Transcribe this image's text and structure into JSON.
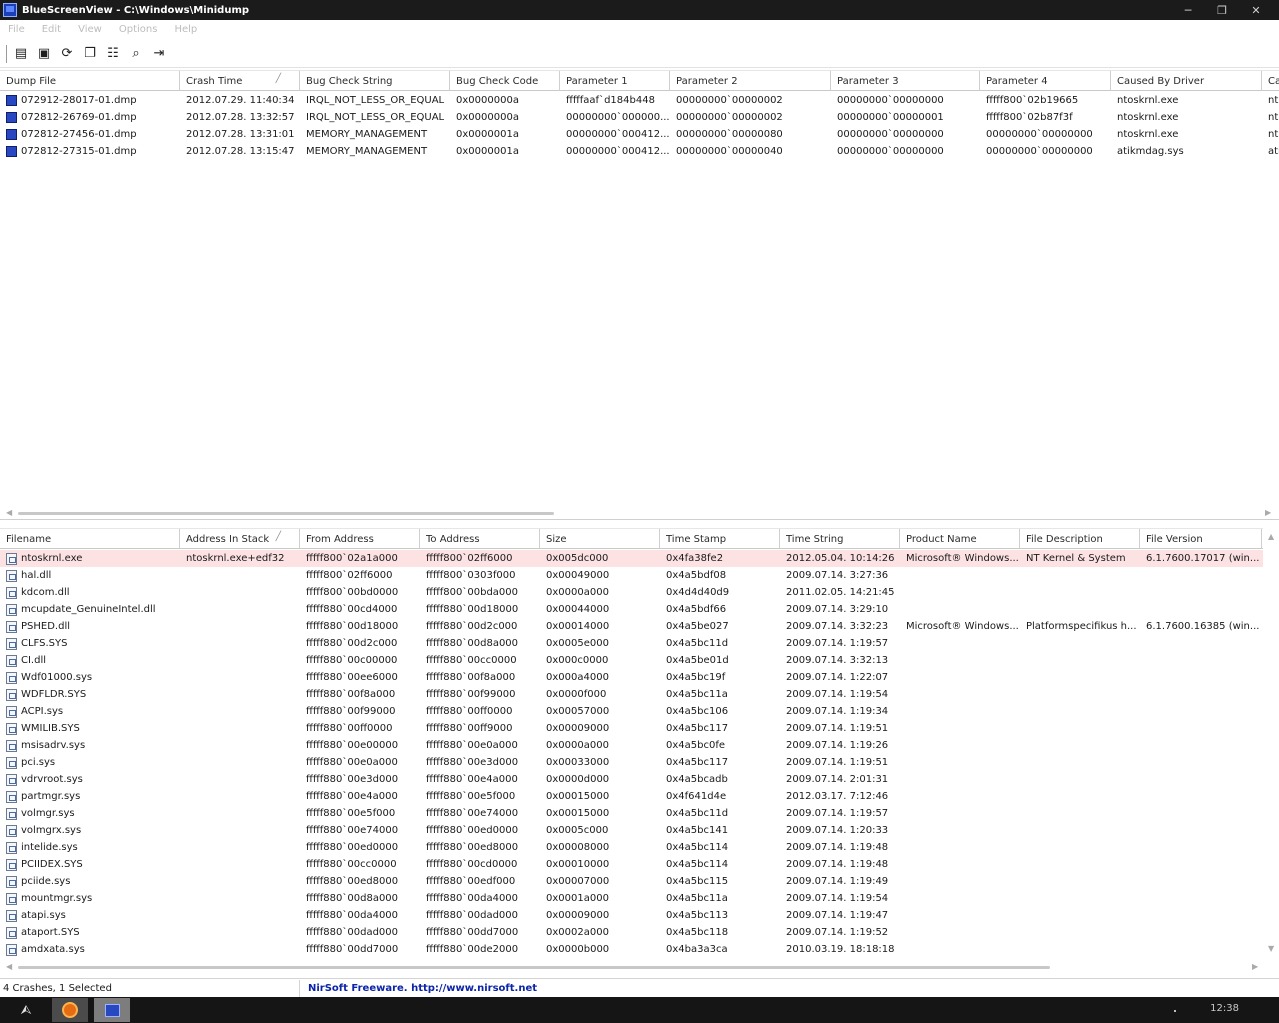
{
  "window": {
    "title": "BlueScreenView  -  C:\\Windows\\Minidump",
    "minimize": "─",
    "restore": "❐",
    "close": "✕"
  },
  "menu": [
    "File",
    "Edit",
    "View",
    "Options",
    "Help"
  ],
  "toolbar": [
    {
      "name": "properties-icon",
      "glyph": "▤"
    },
    {
      "name": "save-icon",
      "glyph": "▣"
    },
    {
      "name": "refresh-icon",
      "glyph": "⟳"
    },
    {
      "name": "copy-icon",
      "glyph": "❐"
    },
    {
      "name": "html-report-icon",
      "glyph": "☷"
    },
    {
      "name": "find-icon",
      "glyph": "⌕"
    },
    {
      "name": "exit-icon",
      "glyph": "⇥"
    }
  ],
  "crash_table": {
    "sorted_column": "Crash Time",
    "columns": [
      {
        "label": "Dump File",
        "width": 180
      },
      {
        "label": "Crash Time",
        "width": 120
      },
      {
        "label": "Bug Check String",
        "width": 150
      },
      {
        "label": "Bug Check Code",
        "width": 110
      },
      {
        "label": "Parameter 1",
        "width": 110
      },
      {
        "label": "Parameter 2",
        "width": 161
      },
      {
        "label": "Parameter 3",
        "width": 149
      },
      {
        "label": "Parameter 4",
        "width": 131
      },
      {
        "label": "Caused By Driver",
        "width": 151
      },
      {
        "label": "Ca",
        "width": 40
      }
    ],
    "rows": [
      [
        "072912-28017-01.dmp",
        "2012.07.29. 11:40:34",
        "IRQL_NOT_LESS_OR_EQUAL",
        "0x0000000a",
        "fffffaaf`d184b448",
        "00000000`00000002",
        "00000000`00000000",
        "fffff800`02b19665",
        "ntoskrnl.exe",
        "nt"
      ],
      [
        "072812-26769-01.dmp",
        "2012.07.28. 13:32:57",
        "IRQL_NOT_LESS_OR_EQUAL",
        "0x0000000a",
        "00000000`000000...",
        "00000000`00000002",
        "00000000`00000001",
        "fffff800`02b87f3f",
        "ntoskrnl.exe",
        "nt"
      ],
      [
        "072812-27456-01.dmp",
        "2012.07.28. 13:31:01",
        "MEMORY_MANAGEMENT",
        "0x0000001a",
        "00000000`000412...",
        "00000000`00000080",
        "00000000`00000000",
        "00000000`00000000",
        "ntoskrnl.exe",
        "nt"
      ],
      [
        "072812-27315-01.dmp",
        "2012.07.28. 13:15:47",
        "MEMORY_MANAGEMENT",
        "0x0000001a",
        "00000000`000412...",
        "00000000`00000040",
        "00000000`00000000",
        "00000000`00000000",
        "atikmdag.sys",
        "ati"
      ]
    ]
  },
  "driver_table": {
    "sorted_column": "Address In Stack",
    "columns": [
      {
        "label": "Filename",
        "width": 180
      },
      {
        "label": "Address In Stack",
        "width": 120
      },
      {
        "label": "From Address",
        "width": 120
      },
      {
        "label": "To Address",
        "width": 120
      },
      {
        "label": "Size",
        "width": 120
      },
      {
        "label": "Time Stamp",
        "width": 120
      },
      {
        "label": "Time String",
        "width": 120
      },
      {
        "label": "Product Name",
        "width": 120
      },
      {
        "label": "File Description",
        "width": 120
      },
      {
        "label": "File Version",
        "width": 122
      }
    ],
    "rows": [
      [
        "ntoskrnl.exe",
        "ntoskrnl.exe+edf32",
        "fffff800`02a1a000",
        "fffff800`02ff6000",
        "0x005dc000",
        "0x4fa38fe2",
        "2012.05.04. 10:14:26",
        "Microsoft® Windows...",
        "NT Kernel & System",
        "6.1.7600.17017 (win..."
      ],
      [
        "hal.dll",
        "",
        "fffff800`02ff6000",
        "fffff800`0303f000",
        "0x00049000",
        "0x4a5bdf08",
        "2009.07.14. 3:27:36",
        "",
        "",
        ""
      ],
      [
        "kdcom.dll",
        "",
        "fffff800`00bd0000",
        "fffff800`00bda000",
        "0x0000a000",
        "0x4d4d40d9",
        "2011.02.05. 14:21:45",
        "",
        "",
        ""
      ],
      [
        "mcupdate_GenuineIntel.dll",
        "",
        "fffff880`00cd4000",
        "fffff880`00d18000",
        "0x00044000",
        "0x4a5bdf66",
        "2009.07.14. 3:29:10",
        "",
        "",
        ""
      ],
      [
        "PSHED.dll",
        "",
        "fffff880`00d18000",
        "fffff880`00d2c000",
        "0x00014000",
        "0x4a5be027",
        "2009.07.14. 3:32:23",
        "Microsoft® Windows...",
        "Platformspecifikus h...",
        "6.1.7600.16385 (win..."
      ],
      [
        "CLFS.SYS",
        "",
        "fffff880`00d2c000",
        "fffff880`00d8a000",
        "0x0005e000",
        "0x4a5bc11d",
        "2009.07.14. 1:19:57",
        "",
        "",
        ""
      ],
      [
        "CI.dll",
        "",
        "fffff880`00c00000",
        "fffff880`00cc0000",
        "0x000c0000",
        "0x4a5be01d",
        "2009.07.14. 3:32:13",
        "",
        "",
        ""
      ],
      [
        "Wdf01000.sys",
        "",
        "fffff880`00ee6000",
        "fffff880`00f8a000",
        "0x000a4000",
        "0x4a5bc19f",
        "2009.07.14. 1:22:07",
        "",
        "",
        ""
      ],
      [
        "WDFLDR.SYS",
        "",
        "fffff880`00f8a000",
        "fffff880`00f99000",
        "0x0000f000",
        "0x4a5bc11a",
        "2009.07.14. 1:19:54",
        "",
        "",
        ""
      ],
      [
        "ACPI.sys",
        "",
        "fffff880`00f99000",
        "fffff880`00ff0000",
        "0x00057000",
        "0x4a5bc106",
        "2009.07.14. 1:19:34",
        "",
        "",
        ""
      ],
      [
        "WMILIB.SYS",
        "",
        "fffff880`00ff0000",
        "fffff880`00ff9000",
        "0x00009000",
        "0x4a5bc117",
        "2009.07.14. 1:19:51",
        "",
        "",
        ""
      ],
      [
        "msisadrv.sys",
        "",
        "fffff880`00e00000",
        "fffff880`00e0a000",
        "0x0000a000",
        "0x4a5bc0fe",
        "2009.07.14. 1:19:26",
        "",
        "",
        ""
      ],
      [
        "pci.sys",
        "",
        "fffff880`00e0a000",
        "fffff880`00e3d000",
        "0x00033000",
        "0x4a5bc117",
        "2009.07.14. 1:19:51",
        "",
        "",
        ""
      ],
      [
        "vdrvroot.sys",
        "",
        "fffff880`00e3d000",
        "fffff880`00e4a000",
        "0x0000d000",
        "0x4a5bcadb",
        "2009.07.14. 2:01:31",
        "",
        "",
        ""
      ],
      [
        "partmgr.sys",
        "",
        "fffff880`00e4a000",
        "fffff880`00e5f000",
        "0x00015000",
        "0x4f641d4e",
        "2012.03.17. 7:12:46",
        "",
        "",
        ""
      ],
      [
        "volmgr.sys",
        "",
        "fffff880`00e5f000",
        "fffff880`00e74000",
        "0x00015000",
        "0x4a5bc11d",
        "2009.07.14. 1:19:57",
        "",
        "",
        ""
      ],
      [
        "volmgrx.sys",
        "",
        "fffff880`00e74000",
        "fffff880`00ed0000",
        "0x0005c000",
        "0x4a5bc141",
        "2009.07.14. 1:20:33",
        "",
        "",
        ""
      ],
      [
        "intelide.sys",
        "",
        "fffff880`00ed0000",
        "fffff880`00ed8000",
        "0x00008000",
        "0x4a5bc114",
        "2009.07.14. 1:19:48",
        "",
        "",
        ""
      ],
      [
        "PCIIDEX.SYS",
        "",
        "fffff880`00cc0000",
        "fffff880`00cd0000",
        "0x00010000",
        "0x4a5bc114",
        "2009.07.14. 1:19:48",
        "",
        "",
        ""
      ],
      [
        "pciide.sys",
        "",
        "fffff880`00ed8000",
        "fffff880`00edf000",
        "0x00007000",
        "0x4a5bc115",
        "2009.07.14. 1:19:49",
        "",
        "",
        ""
      ],
      [
        "mountmgr.sys",
        "",
        "fffff880`00d8a000",
        "fffff880`00da4000",
        "0x0001a000",
        "0x4a5bc11a",
        "2009.07.14. 1:19:54",
        "",
        "",
        ""
      ],
      [
        "atapi.sys",
        "",
        "fffff880`00da4000",
        "fffff880`00dad000",
        "0x00009000",
        "0x4a5bc113",
        "2009.07.14. 1:19:47",
        "",
        "",
        ""
      ],
      [
        "ataport.SYS",
        "",
        "fffff880`00dad000",
        "fffff880`00dd7000",
        "0x0002a000",
        "0x4a5bc118",
        "2009.07.14. 1:19:52",
        "",
        "",
        ""
      ],
      [
        "amdxata.sys",
        "",
        "fffff880`00dd7000",
        "fffff880`00de2000",
        "0x0000b000",
        "0x4ba3a3ca",
        "2010.03.19. 18:18:18",
        "",
        "",
        ""
      ]
    ]
  },
  "status": {
    "count": "4 Crashes, 1 Selected",
    "link": "NirSoft Freeware.  http://www.nirsoft.net"
  },
  "taskbar": {
    "clock": "12:38",
    "start_glyph": "⮙"
  },
  "colors": {
    "selected_row": "#fde2e4",
    "titlebar": "#1b1b1b",
    "link": "#0b24a8"
  }
}
